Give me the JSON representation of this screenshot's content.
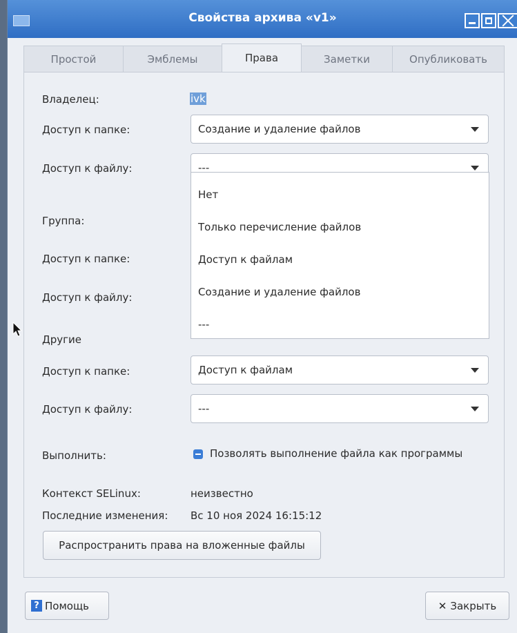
{
  "window": {
    "title": "Свойства архива «v1»"
  },
  "tabs": [
    {
      "label": "Простой"
    },
    {
      "label": "Эмблемы"
    },
    {
      "label": "Права"
    },
    {
      "label": "Заметки"
    },
    {
      "label": "Опубликовать"
    }
  ],
  "active_tab": "Права",
  "owner": {
    "label": "Владелец:",
    "value": "ivk",
    "folder_access_label": "Доступ к папке:",
    "folder_access_value": "Создание и удаление файлов",
    "file_access_label": "Доступ к файлу:",
    "file_access_value": "---"
  },
  "dropdown": {
    "options": [
      "Нет",
      "Только перечисление файлов",
      "Доступ к файлам",
      "Создание и удаление файлов",
      "---"
    ]
  },
  "group": {
    "label": "Группа:",
    "folder_access_label": "Доступ к папке:",
    "file_access_label": "Доступ к файлу:"
  },
  "others": {
    "label": "Другие",
    "folder_access_label": "Доступ к папке:",
    "folder_access_value": "Доступ к файлам",
    "file_access_label": "Доступ к файлу:",
    "file_access_value": "---"
  },
  "execute": {
    "label": "Выполнить:",
    "checkbox_label": "Позволять выполнение файла как программы",
    "state": "indeterminate"
  },
  "selinux": {
    "label": "Контекст SELinux:",
    "value": "неизвестно"
  },
  "modified": {
    "label": "Последние изменения:",
    "value": "Вс 10 ноя 2024 16:15:12"
  },
  "apply_button": "Распространить права на вложенные файлы",
  "footer": {
    "help_label": "Помощь",
    "help_icon_glyph": "?",
    "close_label": "Закрыть",
    "close_icon_glyph": "✕"
  },
  "colors": {
    "titlebar": "#2f6ec4",
    "selection": "#6f9fd9",
    "accent": "#3b7dd6"
  }
}
